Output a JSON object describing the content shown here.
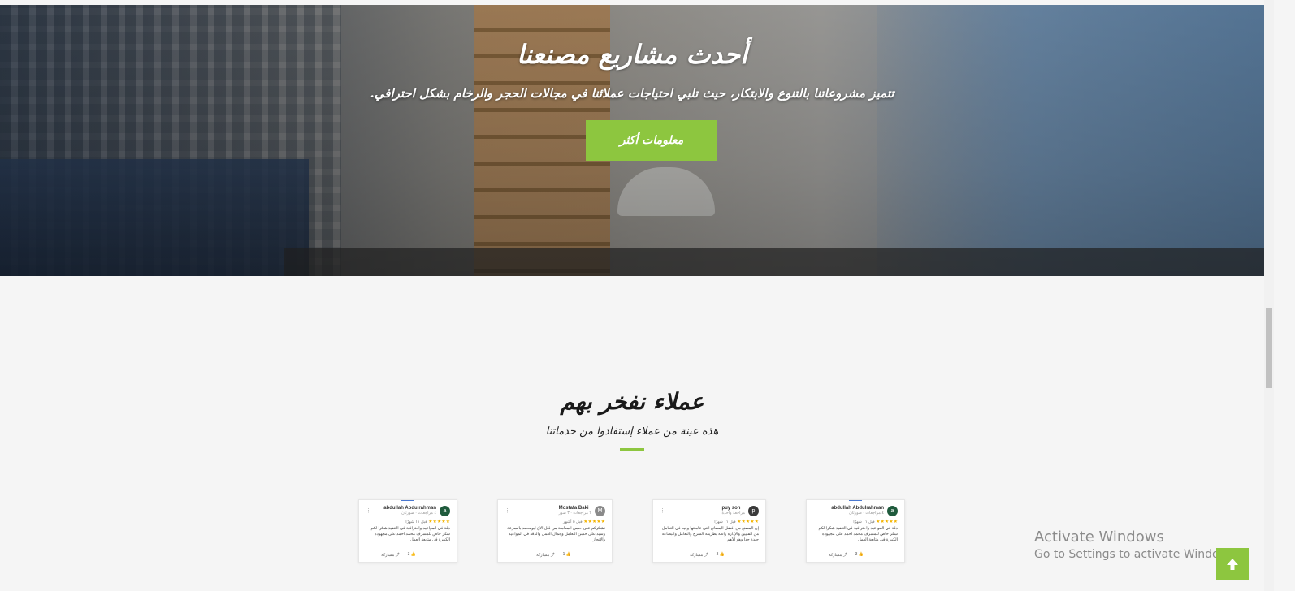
{
  "hero": {
    "title": "أحدث مشاريع مصنعنا",
    "subtitle": "تتميز مشروعاتنا بالتنوع والابتكار، حيث تلبي احتياجات عملائنا في مجالات الحجر والرخام بشكل احترافي.",
    "button_label": "معلومات أكثر",
    "button_color": "#8dc63f"
  },
  "clients": {
    "title": "عملاء نفخر بهم",
    "subtitle": "هذه عينة من عملاء إستفادوا من خدماتنا",
    "accent_color": "#8dc63f"
  },
  "reviews": [
    {
      "name": "abdullah Abdulrahman",
      "avatar_letter": "a",
      "meta": "٤ مراجعات · صورتان",
      "time": "قبل ١١ شهرًا",
      "stars": "★★★★★",
      "text": "دقة في المواعيد واحترافية في التنفيذ شكرا لكم شكر خاص للمشرف محمد احمد على مجهوده الكبيرة في متابعة العمل",
      "likes": "3",
      "share": "مشاركة"
    },
    {
      "name": "Mostafa Baki",
      "avatar_letter": "M",
      "meta": "٢ مراجعات · ٣ صور",
      "time": "قبل ٥ أشهر",
      "stars": "★★★★★",
      "text": "نشكركم على حسن المعاملة من قبل الاخ ابومحمد بالسرعة وسيد على حسن التعامل وجمال العمل والدقة في المواعيد والإنجاز",
      "likes": "1",
      "share": "مشاركة"
    },
    {
      "name": "puy soh",
      "avatar_letter": "p",
      "meta": "مراجعة واحدة",
      "time": "قبل ١١ شهرًا",
      "stars": "★★★★★",
      "text": "إن المصنع من أفضل المصانع التي عاملتها وفيه في التعامل من الفنيين والإدارة رائعة بطريقة الشرح والتعامل والبضاعة جيدة جدا وهو الأهم",
      "likes": "3",
      "share": "مشاركة"
    },
    {
      "name": "abdullah Abdulrahman",
      "avatar_letter": "a",
      "meta": "٤ مراجعات · صورتان",
      "time": "قبل ١١ شهرًا",
      "stars": "★★★★★",
      "text": "دقة في المواعيد واحترافية في التنفيذ شكرا لكم شكر خاص للمشرف محمد احمد على مجهوده الكبيرة في متابعة العمل",
      "likes": "3",
      "share": "مشاركة"
    }
  ],
  "system": {
    "activate_title": "Activate Windows",
    "activate_sub": "Go to Settings to activate Windows."
  },
  "icons": {
    "to_top": "arrow-up-icon"
  }
}
